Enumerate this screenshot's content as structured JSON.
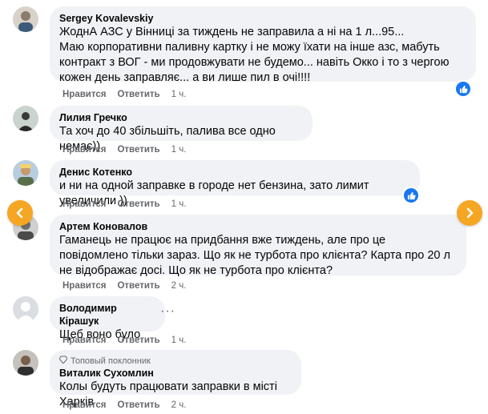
{
  "colors": {
    "bubble": "#f0f2f5",
    "accent": "#1877f2",
    "nav_arrow": "#f5a623",
    "meta": "#65676b"
  },
  "comments": [
    {
      "author": "Sergey Kovalevskiy",
      "text": "ЖоднА АЗС у Вінниці за тиждень не заправила а ні на 1 л...95...\nМаю корпоративни паливну картку і не можу їхати на інше азс, мабуть контракт з ВОГ - ми продовжувати не будемо... навіть Окко і то з чергою кожен день заправляє... а ви лише пил в очі!!!!",
      "like_label": "Нравится",
      "reply_label": "Ответить",
      "time": "1 ч.",
      "has_reaction": true
    },
    {
      "author": "Лилия Гречко",
      "text": "Та хоч до 40 збільшіть, палива все одно немає))",
      "like_label": "Нравится",
      "reply_label": "Ответить",
      "time": "1 ч."
    },
    {
      "author": "Денис Котенко",
      "text": "и ни на одной заправке в городе нет бензина, зато лимит увеличили ))",
      "like_label": "Нравится",
      "reply_label": "Ответить",
      "time": "1 ч.",
      "has_reaction": true
    },
    {
      "author": "Артем Коновалов",
      "text": "Гаманець не працює на придбання вже тиждень, але про це повідомлено тільки зараз. Що як не турбота про клієнта? Карта про 20 л не відображає досі. Що як не турбота про клієнта?",
      "like_label": "Нравится",
      "reply_label": "Ответить",
      "time": "2 ч."
    },
    {
      "author": "Володимир Кірашук",
      "text": "Щеб воно було",
      "like_label": "Нравится",
      "reply_label": "Ответить",
      "time": "1 ч."
    },
    {
      "author": "Виталик Сухомлин",
      "fan_badge": "Топовый поклонник",
      "text": "Колы будуть працювати заправки в місті Харків",
      "like_label": "Нравится",
      "reply_label": "Ответить",
      "time": "2 ч."
    }
  ],
  "icons": {
    "like": "thumbs-up-icon",
    "prev": "chevron-left-icon",
    "next": "chevron-right-icon",
    "more": "more-options-icon",
    "fan": "diamond-icon"
  }
}
